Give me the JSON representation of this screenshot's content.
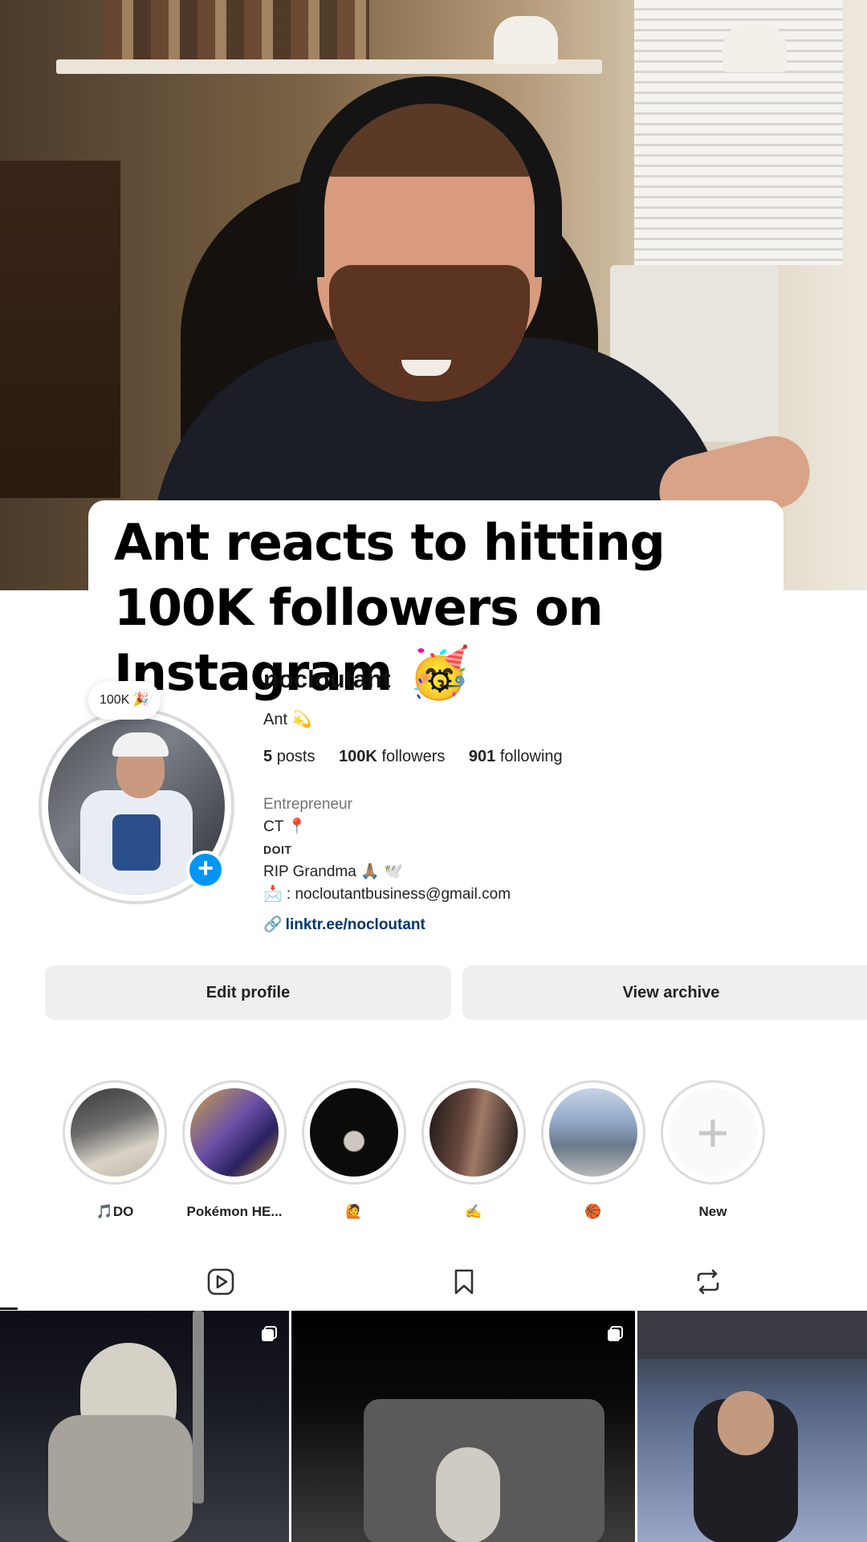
{
  "caption": "Ant reacts to hitting 100K followers on Instagram 🥳",
  "profile": {
    "note": "100K 🎉",
    "username": "nocloutant",
    "full_name": "Ant 💫",
    "stats": {
      "posts_count": "5",
      "posts_label": "posts",
      "followers_count": "100K",
      "followers_label": "followers",
      "following_count": "901",
      "following_label": "following"
    },
    "bio": {
      "category": "Entrepreneur",
      "line1": "CT 📍",
      "line2": "DOIT",
      "line3": "RIP Grandma 🙏🏽 🕊️",
      "line4": "📩 : nocloutantbusiness@gmail.com"
    },
    "link": "linktr.ee/nocloutant"
  },
  "buttons": {
    "edit_profile": "Edit profile",
    "view_archive": "View archive"
  },
  "highlights": [
    {
      "label": "🎵DO"
    },
    {
      "label": "Pokémon HE..."
    },
    {
      "label": "🙋"
    },
    {
      "label": "✍️"
    },
    {
      "label": "🏀"
    },
    {
      "label": "New"
    }
  ],
  "tabs": [
    "reels-icon",
    "saved-icon",
    "tagged-icon"
  ],
  "colors": {
    "accent_blue": "#0095f6",
    "link_blue": "#00376b",
    "button_gray": "#efefef",
    "ring_gray": "#dbdbdb"
  }
}
